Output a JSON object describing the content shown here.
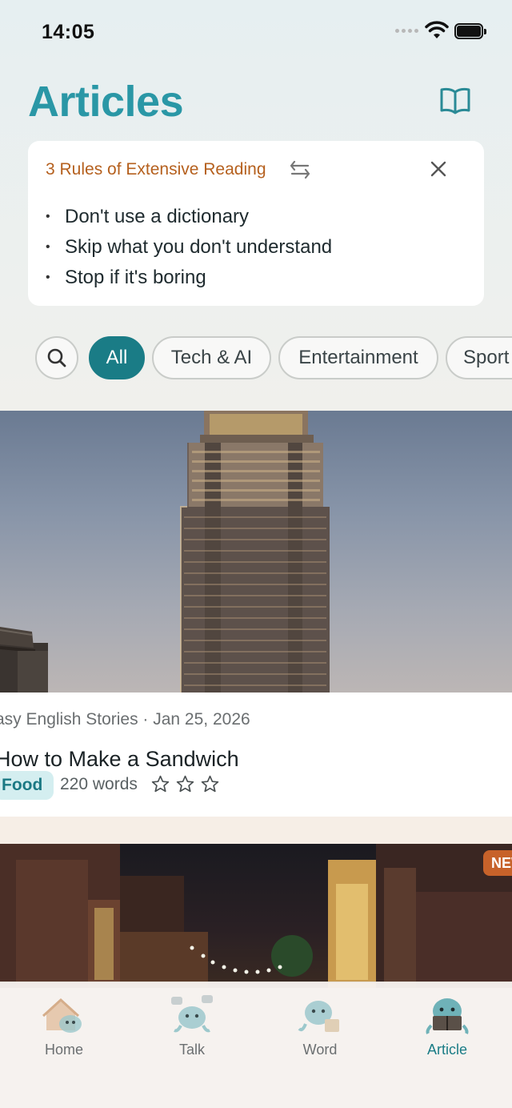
{
  "status_bar": {
    "time": "14:05"
  },
  "header": {
    "title": "Articles",
    "book_icon": "book-open-icon"
  },
  "rules_card": {
    "title": "3 Rules of Extensive Reading",
    "rules": [
      "Don't use a dictionary",
      "Skip what you don't understand",
      "Stop if it's boring"
    ]
  },
  "filters": {
    "search_icon": "search-icon",
    "chips": [
      {
        "label": "All",
        "selected": true
      },
      {
        "label": "Tech & AI",
        "selected": false
      },
      {
        "label": "Entertainment",
        "selected": false
      },
      {
        "label": "Sport",
        "selected": false
      }
    ]
  },
  "articles": [
    {
      "meta": "asy English Stories · Jan 25, 2026",
      "title": "How to Make a Sandwich",
      "tag": "Food",
      "word_count": "220 words",
      "rating": 0,
      "rating_max": 3
    },
    {
      "badge": "NEW"
    }
  ],
  "tabs": [
    {
      "label": "Home",
      "active": false
    },
    {
      "label": "Talk",
      "active": false
    },
    {
      "label": "Word",
      "active": false
    },
    {
      "label": "Article",
      "active": true
    }
  ],
  "colors": {
    "accent": "#2a97a6",
    "active_chip": "#1a7c86",
    "rules_title": "#b5601e",
    "tag_bg": "#d4eef0",
    "new_badge": "#c7622a"
  }
}
